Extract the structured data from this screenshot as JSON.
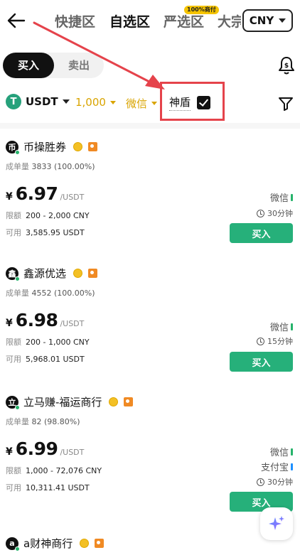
{
  "nav": {
    "tabs": [
      {
        "label": "快捷区"
      },
      {
        "label": "自选区"
      },
      {
        "label": "严选区"
      },
      {
        "label": "大宗"
      }
    ],
    "tab_badge": "100%商付",
    "currency": "CNY"
  },
  "trade_side": {
    "buy_label": "买入",
    "sell_label": "卖出"
  },
  "filters": {
    "coin": "USDT",
    "coin_icon_letter": "T",
    "amount": "1,000",
    "payment": "微信",
    "shield_label": "神盾",
    "shield_checked": true
  },
  "merchants": [
    {
      "avatar": "币",
      "name": "币操胜券",
      "orders_label": "成单量",
      "orders_value": "3833 (100.00%)",
      "currency_symbol": "¥",
      "price": "6.97",
      "price_unit": "/USDT",
      "limit_label": "限额",
      "limit_value": "200 - 2,000 CNY",
      "avail_label": "可用",
      "avail_value": "3,585.95 USDT",
      "payments": [
        "微信"
      ],
      "time_limit": "30分钟",
      "buy_label": "买入"
    },
    {
      "avatar": "鑫",
      "name": "鑫源优选",
      "orders_label": "成单量",
      "orders_value": "4552 (100.00%)",
      "currency_symbol": "¥",
      "price": "6.98",
      "price_unit": "/USDT",
      "limit_label": "限额",
      "limit_value": "200 - 1,000 CNY",
      "avail_label": "可用",
      "avail_value": "5,968.01 USDT",
      "payments": [
        "微信"
      ],
      "time_limit": "15分钟",
      "buy_label": "买入"
    },
    {
      "avatar": "立",
      "name": "立马赚-福运商行",
      "orders_label": "成单量",
      "orders_value": "82 (98.80%)",
      "currency_symbol": "¥",
      "price": "6.99",
      "price_unit": "/USDT",
      "limit_label": "限额",
      "limit_value": "1,000 - 72,076 CNY",
      "avail_label": "可用",
      "avail_value": "10,311.41 USDT",
      "payments": [
        "微信",
        "支付宝"
      ],
      "time_limit": "30分钟",
      "buy_label": "买入"
    },
    {
      "avatar": "a",
      "name": "a财神商行"
    }
  ],
  "colors": {
    "buy_green": "#26b07a",
    "accent_gold": "#d9a400",
    "highlight_red": "#e5434b"
  }
}
